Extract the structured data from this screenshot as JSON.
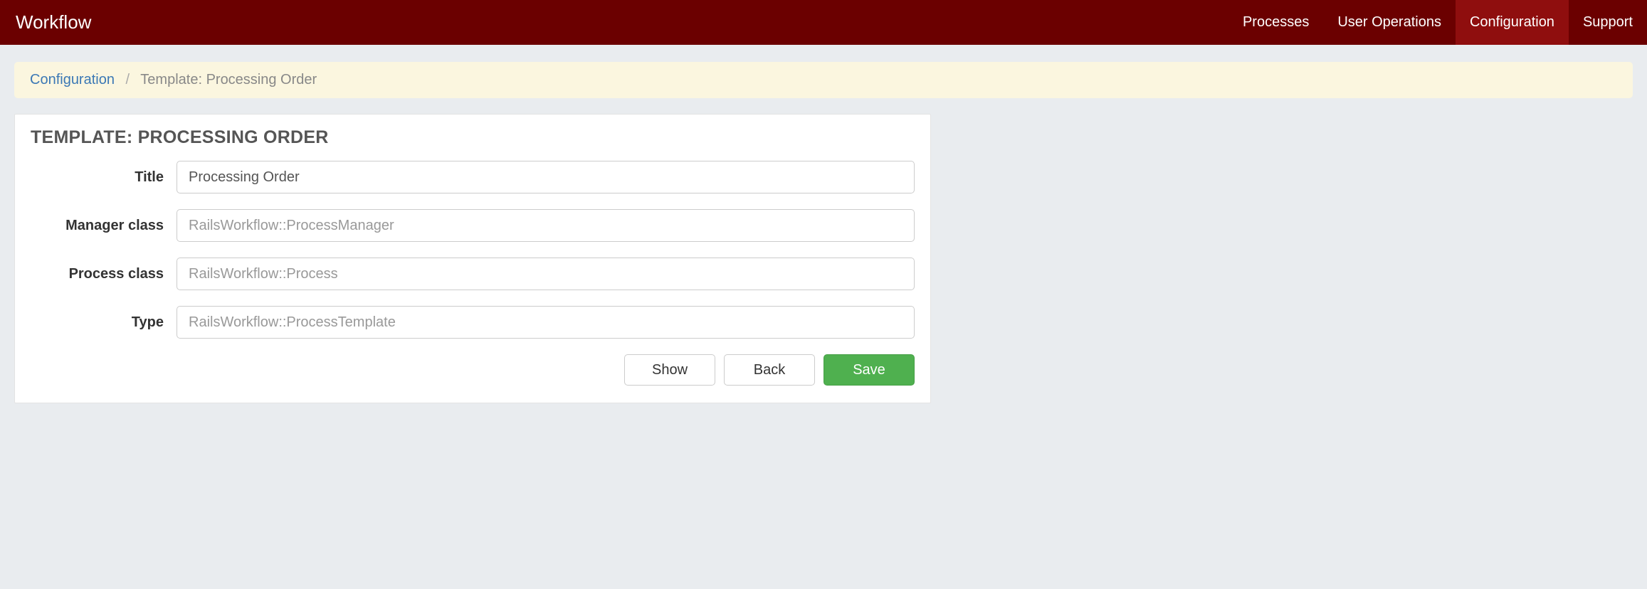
{
  "navbar": {
    "brand": "Workflow",
    "items": [
      {
        "label": "Processes",
        "active": false
      },
      {
        "label": "User Operations",
        "active": false
      },
      {
        "label": "Configuration",
        "active": true
      },
      {
        "label": "Support",
        "active": false
      }
    ]
  },
  "breadcrumb": {
    "link_label": "Configuration",
    "separator": "/",
    "current": "Template: Processing Order"
  },
  "panel": {
    "title": "TEMPLATE: PROCESSING ORDER"
  },
  "form": {
    "title": {
      "label": "Title",
      "value": "Processing Order",
      "placeholder": ""
    },
    "manager_class": {
      "label": "Manager class",
      "value": "",
      "placeholder": "RailsWorkflow::ProcessManager"
    },
    "process_class": {
      "label": "Process class",
      "value": "",
      "placeholder": "RailsWorkflow::Process"
    },
    "type": {
      "label": "Type",
      "value": "",
      "placeholder": "RailsWorkflow::ProcessTemplate"
    }
  },
  "buttons": {
    "show": "Show",
    "back": "Back",
    "save": "Save"
  }
}
